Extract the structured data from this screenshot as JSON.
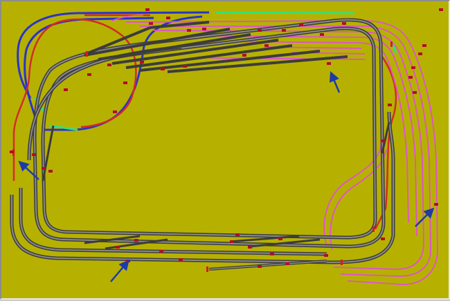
{
  "colors": {
    "board": "#b6b100",
    "track_grey": "#3c3c3c",
    "track_grey_inner": "#8a8a8a",
    "track_blue": "#2a33c8",
    "track_red": "#d42a2a",
    "track_magenta": "#e14fd4",
    "track_green": "#34e07a",
    "bumper": "#e01818",
    "signal": "#b20d2a",
    "arrow": "#1e3aa8"
  },
  "legend_tracks": [
    {
      "name": "main-loop",
      "color_key": "track_grey"
    },
    {
      "name": "upper-helix",
      "color_key": "track_blue"
    },
    {
      "name": "lower-helix",
      "color_key": "track_red"
    },
    {
      "name": "fiddle-yard",
      "color_key": "track_magenta"
    },
    {
      "name": "transition",
      "color_key": "track_green"
    }
  ],
  "arrows": [
    {
      "name": "arrow-top-right",
      "label": ""
    },
    {
      "name": "arrow-left",
      "label": ""
    },
    {
      "name": "arrow-bottom-left",
      "label": ""
    },
    {
      "name": "arrow-right",
      "label": ""
    }
  ]
}
